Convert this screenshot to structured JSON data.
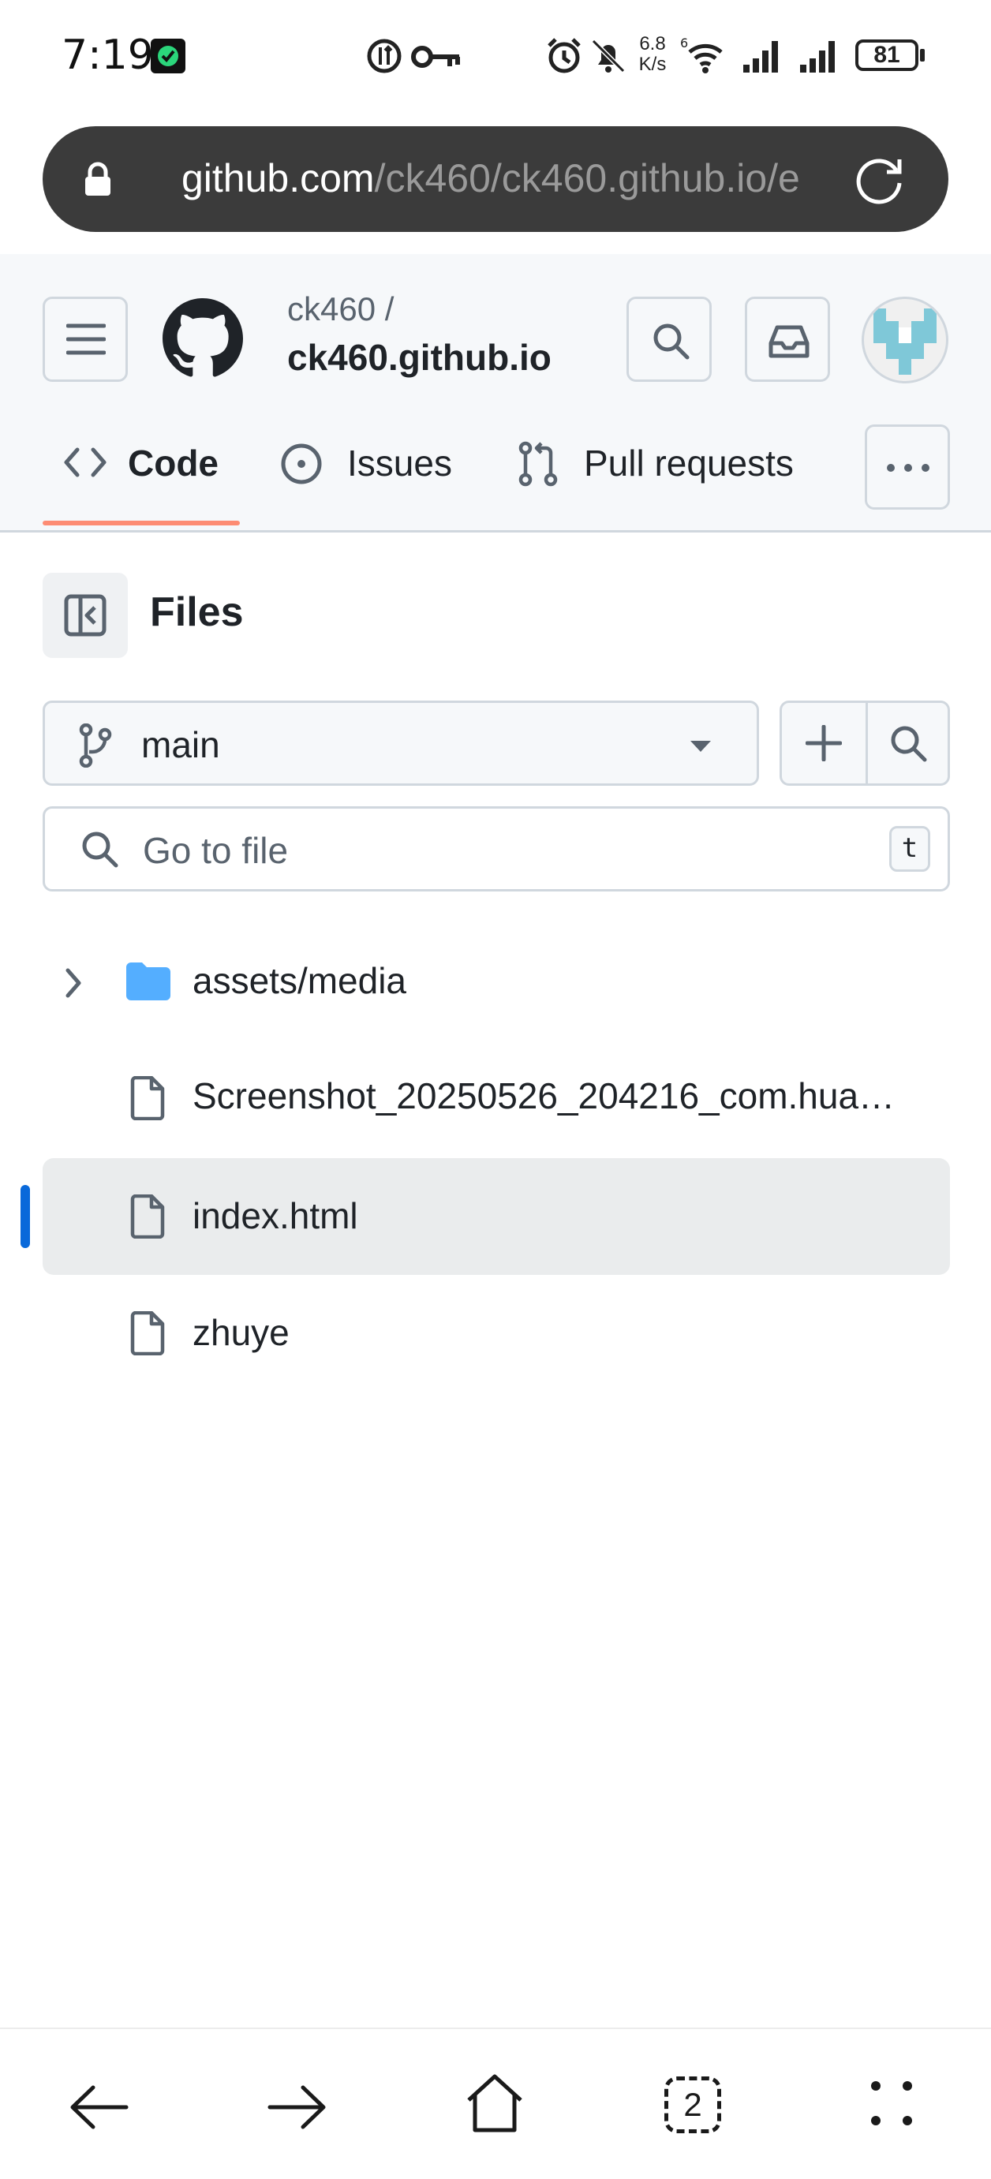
{
  "status_bar": {
    "time": "7:19",
    "net_speed_value": "6.8",
    "net_speed_unit": "K/s",
    "battery": "81",
    "icons": [
      "app-notification-icon",
      "data-saver-icon",
      "vpn-key-icon",
      "alarm-icon",
      "silent-bell-icon",
      "wifi-6-icon",
      "signal-icon",
      "signal-icon",
      "battery-icon"
    ]
  },
  "browser": {
    "url_host": "github.com",
    "url_path": "/ck460/ck460.github.io/e",
    "reload_icon": "reload-icon"
  },
  "repo": {
    "owner": "ck460 /",
    "name": "ck460.github.io"
  },
  "tabs": [
    {
      "label": "Code",
      "icon": "code-icon",
      "active": true
    },
    {
      "label": "Issues",
      "icon": "issue-circle-icon",
      "active": false
    },
    {
      "label": "Pull requests",
      "icon": "pull-request-icon",
      "active": false
    }
  ],
  "files_panel": {
    "title": "Files",
    "branch": "main",
    "search_placeholder": "Go to file",
    "shortcut_key": "t"
  },
  "tree": [
    {
      "name": "assets/media",
      "type": "folder",
      "selected": false
    },
    {
      "name": "Screenshot_20250526_204216_com.hua…",
      "type": "file",
      "selected": false
    },
    {
      "name": "index.html",
      "type": "file",
      "selected": true
    },
    {
      "name": "zhuye",
      "type": "file",
      "selected": false
    }
  ],
  "bottom_nav": {
    "tab_count": "2"
  },
  "colors": {
    "accent_underline": "#fd8c73",
    "selection_marker": "#0969da",
    "folder": "#54aeff",
    "header_bg": "#f6f8fa"
  }
}
